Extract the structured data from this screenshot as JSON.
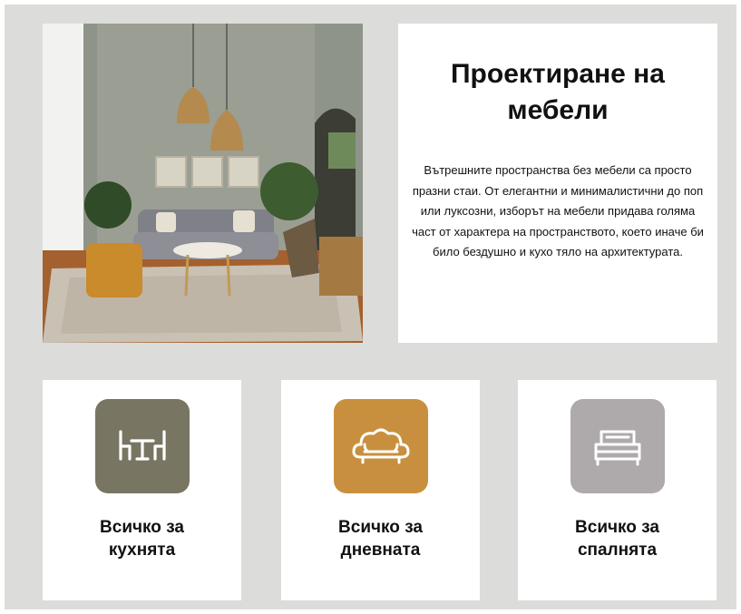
{
  "intro": {
    "title_line1": "Проектиране на",
    "title_line2": "мебели",
    "description": "Вътрешните пространства без мебели са просто празни стаи. От елегантни и минималистични до поп или луксозни, изборът на мебели придава голяма част от характера на пространството, което иначе би било бездушно и кухо тяло на архитектурата."
  },
  "photo": {
    "subject": "living-room-interior"
  },
  "cards": [
    {
      "line1": "Всичко за",
      "line2": "кухнята",
      "icon": "dining-set-icon",
      "color": "#787563"
    },
    {
      "line1": "Всичко за",
      "line2": "дневната",
      "icon": "sofa-icon",
      "color": "#c8903e"
    },
    {
      "line1": "Всичко за",
      "line2": "спалнята",
      "icon": "bed-icon",
      "color": "#aeaaab"
    }
  ],
  "colors": {
    "background": "#dcdcda",
    "panel": "#ffffff",
    "text": "#111111"
  }
}
